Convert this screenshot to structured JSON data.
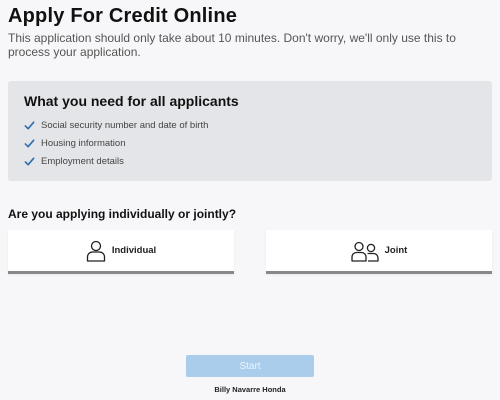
{
  "header": {
    "title": "Apply For Credit Online",
    "intro": "This application should only take about 10 minutes. Don't worry, we'll only use this to process your application."
  },
  "requirements": {
    "title": "What you need for all applicants",
    "items": [
      "Social security number and date of birth",
      "Housing information",
      "Employment details"
    ],
    "check_icon": "check-icon",
    "check_color": "#2f6fb0"
  },
  "applicant_type": {
    "question": "Are you applying individually or jointly?",
    "options": [
      {
        "label": "Individual",
        "icon": "person-icon"
      },
      {
        "label": "Joint",
        "icon": "two-people-icon"
      }
    ]
  },
  "actions": {
    "start_label": "Start",
    "start_color": "#a9cdea",
    "start_enabled": false
  },
  "footer": {
    "dealer": "Billy Navarre Honda"
  }
}
